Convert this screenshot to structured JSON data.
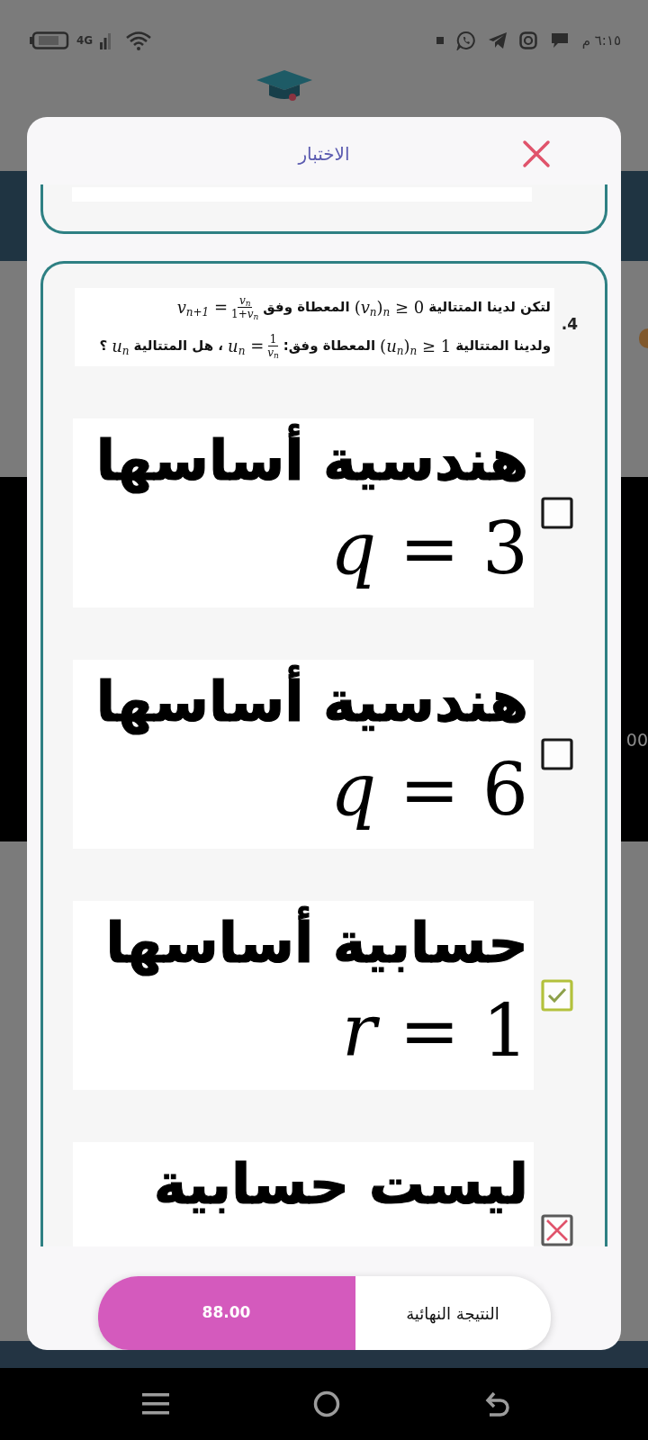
{
  "status_bar": {
    "network": "4G",
    "time": "٦:١٥ م"
  },
  "background": {
    "edge_text": "00"
  },
  "dialog": {
    "title": "الاختبار"
  },
  "question": {
    "number": "4.",
    "lines": [
      [
        {
          "kind": "text",
          "text": "لتكن لدينا المتتالية"
        },
        {
          "kind": "math",
          "text": "(*v*$_{n}$)$_{n}$ ≥ 0"
        },
        {
          "kind": "text",
          "text": "المعطاة وفق"
        },
        {
          "kind": "fraction",
          "lhs": "*v*$_{n+1}$ =",
          "numerator": "*v*$_{n}$",
          "denominator": "1+*v*$_{n}$"
        }
      ],
      [
        {
          "kind": "text",
          "text": "ولدينا المتتالية"
        },
        {
          "kind": "math",
          "text": "(*u*$_{n}$)$_{n}$ ≥ 1"
        },
        {
          "kind": "text",
          "text": "المعطاة وفق:"
        },
        {
          "kind": "fraction",
          "lhs": "*u*$_{n}$ =",
          "numerator": "1",
          "denominator": "*v*$_{n}$"
        },
        {
          "kind": "text",
          "text": "، هل المتتالية"
        },
        {
          "kind": "math",
          "text": "*u*$_{n}$"
        },
        {
          "kind": "text",
          "text": "؟"
        }
      ]
    ]
  },
  "options": [
    {
      "text": "هندسية أساسها",
      "formula": "*q* = 3",
      "checked": false,
      "marked_wrong": false
    },
    {
      "text": "هندسية أساسها",
      "formula": "*q* = 6",
      "checked": false,
      "marked_wrong": false
    },
    {
      "text": "حسابية أساسها",
      "formula": "*r* = 1",
      "checked": true,
      "marked_wrong": false
    },
    {
      "text": "ليست حسابية",
      "checked": false,
      "marked_wrong": true
    }
  ],
  "result": {
    "label": "النتيجة النهائية",
    "score": "88.00"
  }
}
